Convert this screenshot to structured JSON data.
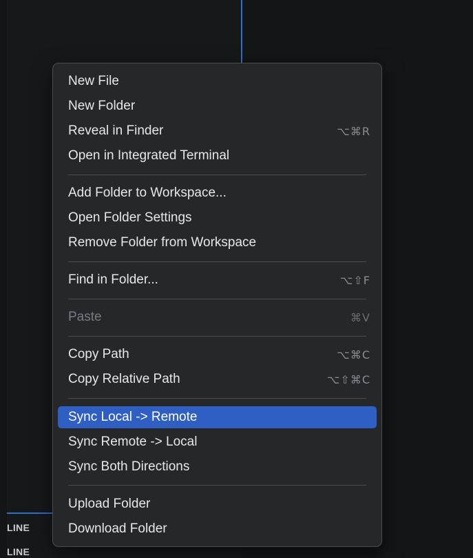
{
  "background": {
    "outline_labels": [
      "LINE",
      "LINE"
    ]
  },
  "menu": {
    "items": {
      "new_file": {
        "label": "New File",
        "shortcut": ""
      },
      "new_folder": {
        "label": "New Folder",
        "shortcut": ""
      },
      "reveal_in_finder": {
        "label": "Reveal in Finder",
        "shortcut": "⌥⌘R"
      },
      "open_integrated_terminal": {
        "label": "Open in Integrated Terminal",
        "shortcut": ""
      },
      "add_folder_to_workspace": {
        "label": "Add Folder to Workspace...",
        "shortcut": ""
      },
      "open_folder_settings": {
        "label": "Open Folder Settings",
        "shortcut": ""
      },
      "remove_folder_from_workspace": {
        "label": "Remove Folder from Workspace",
        "shortcut": ""
      },
      "find_in_folder": {
        "label": "Find in Folder...",
        "shortcut": "⌥⇧F"
      },
      "paste": {
        "label": "Paste",
        "shortcut": "⌘V",
        "disabled": true
      },
      "copy_path": {
        "label": "Copy Path",
        "shortcut": "⌥⌘C"
      },
      "copy_relative_path": {
        "label": "Copy Relative Path",
        "shortcut": "⌥⇧⌘C"
      },
      "sync_local_remote": {
        "label": "Sync Local -> Remote",
        "shortcut": "",
        "highlighted": true
      },
      "sync_remote_local": {
        "label": "Sync Remote -> Local",
        "shortcut": ""
      },
      "sync_both": {
        "label": "Sync Both Directions",
        "shortcut": ""
      },
      "upload_folder": {
        "label": "Upload Folder",
        "shortcut": ""
      },
      "download_folder": {
        "label": "Download Folder",
        "shortcut": ""
      }
    }
  },
  "colors": {
    "menu_background": "#262729",
    "highlight": "#2f5fc3",
    "accent_line": "#2f6fd0",
    "text": "#e6e7e9",
    "disabled_text": "#7a7c80"
  }
}
